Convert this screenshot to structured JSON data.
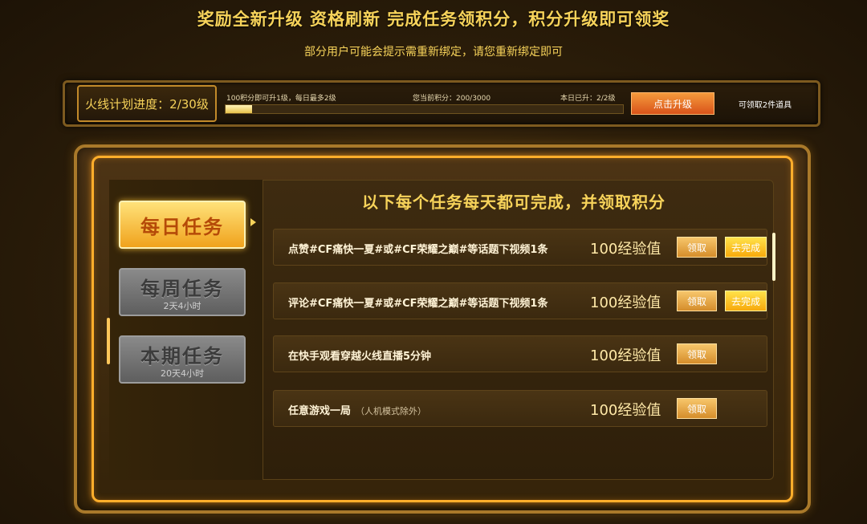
{
  "header": {
    "headline": "奖励全新升级  资格刷新  完成任务领积分，积分升级即可领奖",
    "subline": "部分用户可能会提示需重新绑定，请您重新绑定即可"
  },
  "progress": {
    "label": "火线计划进度：2/30级",
    "rule": "100积分即可升1级，每日最多2级",
    "points": "您当前积分：200/3000",
    "today": "本日已升：2/2级",
    "fill": 0.067,
    "upgrade_button": "点击升级",
    "items_text": "可领取2件道具"
  },
  "tabs": [
    {
      "title": "每日任务",
      "sub": ""
    },
    {
      "title": "每周任务",
      "sub": "2天4小时"
    },
    {
      "title": "本期任务",
      "sub": "20天4小时"
    }
  ],
  "list": {
    "title": "以下每个任务每天都可完成，并领取积分",
    "tasks": [
      {
        "text": "点赞#CF痛快一夏#或#CF荣耀之巅#等话题下视频1条",
        "note": "",
        "reward": "100经验值",
        "claim": "领取",
        "go": "去完成"
      },
      {
        "text": "评论#CF痛快一夏#或#CF荣耀之巅#等话题下视频1条",
        "note": "",
        "reward": "100经验值",
        "claim": "领取",
        "go": "去完成"
      },
      {
        "text": "在快手观看穿越火线直播5分钟",
        "note": "",
        "reward": "100经验值",
        "claim": "领取",
        "go": ""
      },
      {
        "text": "任意游戏一局",
        "note": "（人机模式除外）",
        "reward": "100经验值",
        "claim": "领取",
        "go": ""
      }
    ]
  },
  "colors": {
    "accent": "#f7d35a",
    "upgrade": "#d9531a",
    "frame": "#ffae2b"
  }
}
